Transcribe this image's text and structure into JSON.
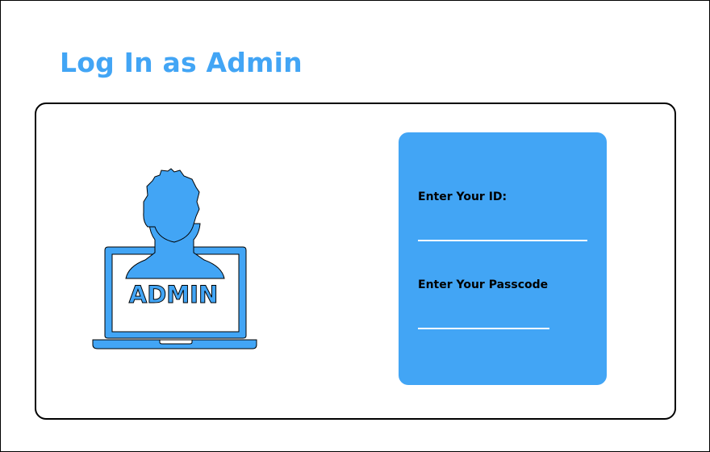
{
  "page": {
    "title": "Log In as Admin"
  },
  "illustration": {
    "screen_text": "ADMIN",
    "icon": "admin-user-laptop-icon"
  },
  "login_form": {
    "id_label": "Enter Your ID:",
    "id_value": "",
    "passcode_label": "Enter Your Passcode",
    "passcode_value": ""
  },
  "colors": {
    "accent": "#42a5f5",
    "border": "#000000",
    "background": "#ffffff"
  }
}
